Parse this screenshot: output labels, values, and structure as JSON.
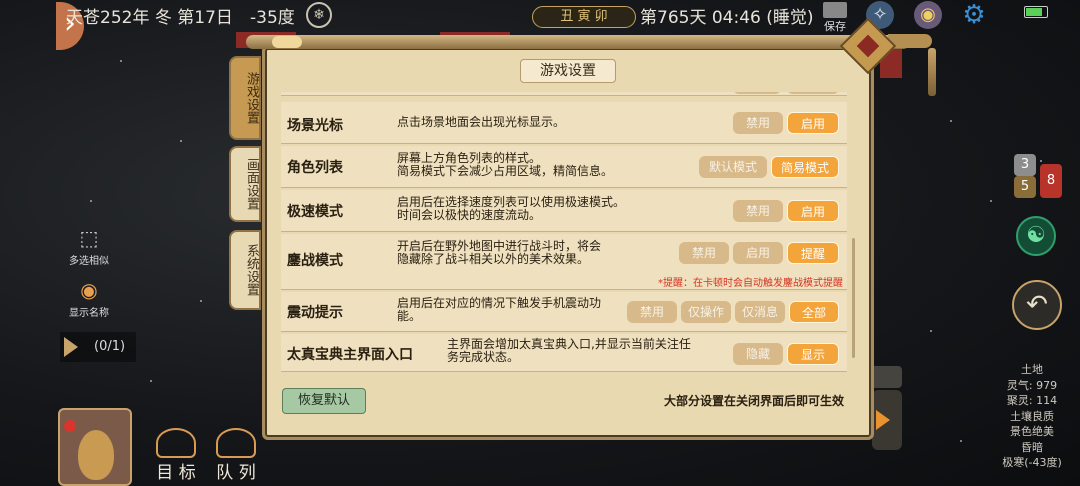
{
  "topbar": {
    "date": "天苍252年 冬 第17日",
    "temperature": "-35度",
    "ganzhi": "丑 寅 卯",
    "day_time": "第765天 04:46 (睡觉)",
    "save_label": "保存"
  },
  "left_tools": [
    {
      "icon": "multi-select-icon",
      "label": "多选相似"
    },
    {
      "icon": "eye-icon",
      "label": "显示名称"
    }
  ],
  "progress": "(0/1)",
  "bottom_nav": [
    {
      "icon": "target-icon",
      "label": "目 标"
    },
    {
      "icon": "queue-icon",
      "label": "队 列"
    }
  ],
  "right_badges": {
    "a": "3",
    "b": "5",
    "c": "8"
  },
  "land_info": [
    "土地",
    "灵气: 979",
    "聚灵: 114",
    "土壤良质",
    "景色绝美",
    "昏暗",
    "极寒(-43度)"
  ],
  "panel": {
    "title": "游戏设置",
    "tabs": [
      "游戏设置",
      "画面设置",
      "系统设置"
    ],
    "rows": [
      {
        "name": "场景光标",
        "desc": [
          "点击场景地面会出现光标显示。"
        ],
        "options": [
          "禁用",
          "启用"
        ],
        "selected": 1
      },
      {
        "name": "角色列表",
        "desc": [
          "屏幕上方角色列表的样式。",
          "简易模式下会减少占用区域，精简信息。"
        ],
        "options": [
          "默认模式",
          "简易模式"
        ],
        "selected": 1
      },
      {
        "name": "极速模式",
        "desc": [
          "启用后在选择速度列表可以使用极速模式。",
          "时间会以极快的速度流动。"
        ],
        "options": [
          "禁用",
          "启用"
        ],
        "selected": 1
      },
      {
        "name": "鏖战模式",
        "desc": [
          "开启后在野外地图中进行战斗时，将会",
          "隐藏除了战斗相关以外的美术效果。"
        ],
        "options": [
          "禁用",
          "启用",
          "提醒"
        ],
        "selected": 2,
        "warning": "*提醒：在卡顿时会自动触发鏖战模式提醒"
      },
      {
        "name": "震动提示",
        "desc": [
          "启用后在对应的情况下触发手机震动功",
          "能。"
        ],
        "options": [
          "禁用",
          "仅操作",
          "仅消息",
          "全部"
        ],
        "selected": 3
      },
      {
        "name": "太真宝典主界面入口",
        "desc": [
          "主界面会增加太真宝典入口,并显示当前关注任",
          "务完成状态。"
        ],
        "options": [
          "隐藏",
          "显示"
        ],
        "selected": 1
      }
    ],
    "reset_label": "恢复默认",
    "footer_note": "大部分设置在关闭界面后即可生效"
  }
}
